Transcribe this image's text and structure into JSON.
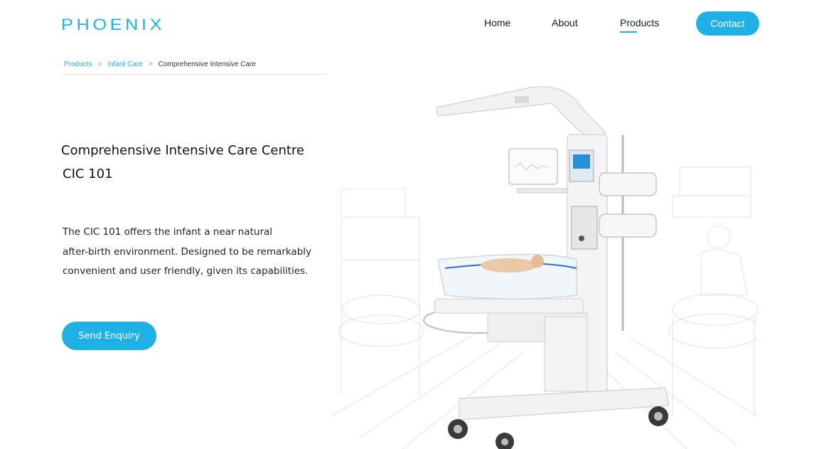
{
  "brand": {
    "logo_text": "PHOENIX",
    "accent_color": "#1fb1e6"
  },
  "nav": {
    "items": [
      {
        "label": "Home"
      },
      {
        "label": "About"
      },
      {
        "label": "Products",
        "active": true
      }
    ],
    "contact_label": "Contact"
  },
  "breadcrumb": {
    "items": [
      "Products",
      "Infant Care",
      "Comprehensive Intensive Care"
    ],
    "separator": ">"
  },
  "product": {
    "title": "Comprehensive Intensive Care Centre",
    "model": "CIC 101",
    "description_lines": [
      "The CIC 101 offers the infant a near natural",
      "after-birth environment. Designed to be remarkably",
      "convenient and user friendly, given its capabilities."
    ],
    "enquiry_label": "Send Enquiry",
    "image": "infant-care-warmer-illustration"
  }
}
